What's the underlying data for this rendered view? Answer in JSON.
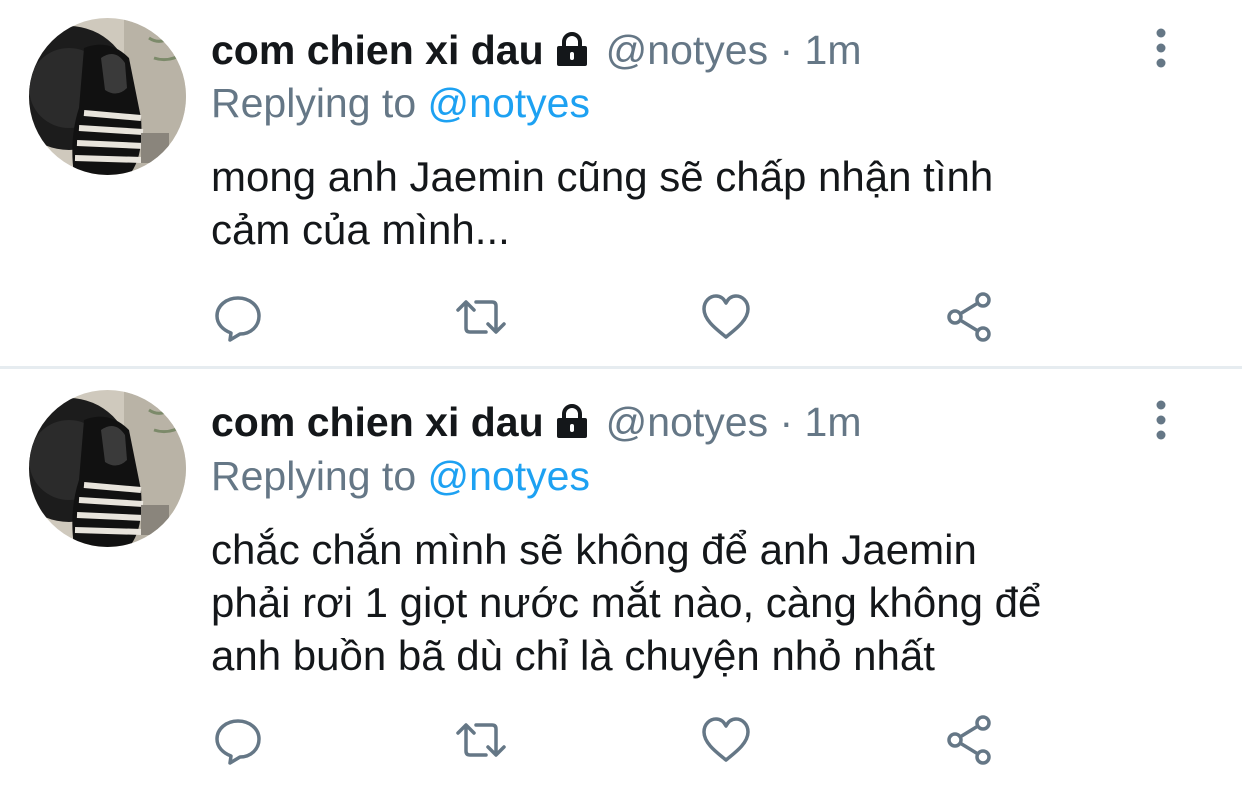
{
  "tweets": [
    {
      "display_name": "com chien xi dau",
      "handle": "@notyes",
      "separator": "·",
      "time": "1m",
      "replying_prefix": "Replying to",
      "replying_to": "@notyes",
      "text": "mong anh Jaemin cũng sẽ chấp nhận tình\ncảm của mình..."
    },
    {
      "display_name": "com chien xi dau",
      "handle": "@notyes",
      "separator": "·",
      "time": "1m",
      "replying_prefix": "Replying to",
      "replying_to": "@notyes",
      "text": "chắc chắn mình sẽ không để anh Jaemin\nphải rơi 1 giọt nước mắt nào, càng không để\nanh buồn bã dù chỉ là chuyện nhỏ nhất"
    }
  ],
  "icons": {
    "lock": "lock-icon",
    "more": "more-vertical-icon",
    "reply": "reply-icon",
    "retweet": "retweet-icon",
    "like": "heart-icon",
    "share": "share-icon"
  },
  "colors": {
    "text_primary": "#14171a",
    "text_secondary": "#657786",
    "link": "#1da1f2",
    "icon": "#657786",
    "separator": "#e6ecf0"
  }
}
